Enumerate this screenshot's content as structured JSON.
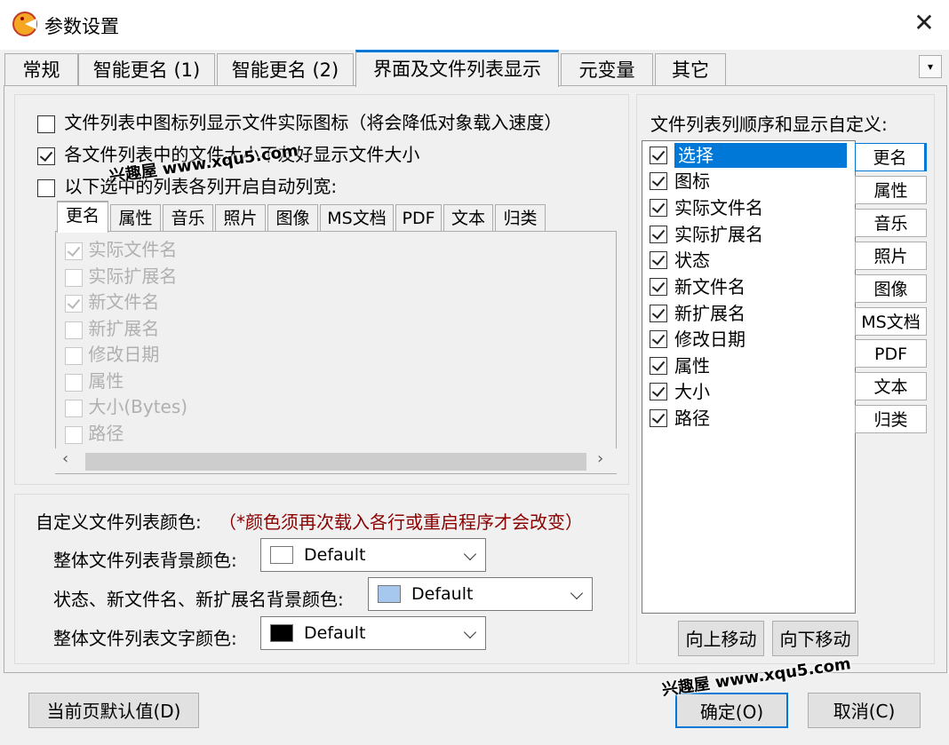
{
  "window": {
    "title": "参数设置",
    "close_glyph": "✕"
  },
  "tabs": [
    {
      "label": "常规"
    },
    {
      "label": "智能更名 (1)"
    },
    {
      "label": "智能更名 (2)"
    },
    {
      "label": "界面及文件列表显示",
      "active": true
    },
    {
      "label": "元变量"
    },
    {
      "label": "其它"
    }
  ],
  "tab_dropdown_glyph": "▾",
  "options": {
    "actual_icon": {
      "label": "文件列表中图标列显示文件实际图标（将会降低对象载入速度）",
      "checked": false
    },
    "friendly_size": {
      "label": "各文件列表中的文件大小不友好显示文件大小",
      "checked": true
    },
    "auto_width": {
      "label": "以下选中的列表各列开启自动列宽:",
      "checked": false
    }
  },
  "inner_tabs": [
    "更名",
    "属性",
    "音乐",
    "照片",
    "图像",
    "MS文档",
    "PDF",
    "文本",
    "归类"
  ],
  "inner_list": [
    {
      "label": "实际文件名",
      "checked": true
    },
    {
      "label": "实际扩展名",
      "checked": false
    },
    {
      "label": "新文件名",
      "checked": true
    },
    {
      "label": "新扩展名",
      "checked": false
    },
    {
      "label": "修改日期",
      "checked": false
    },
    {
      "label": "属性",
      "checked": false
    },
    {
      "label": "大小(Bytes)",
      "checked": false
    },
    {
      "label": "路径",
      "checked": false
    }
  ],
  "scroll": {
    "left": "‹",
    "right": "›"
  },
  "colors_section": {
    "heading": "自定义文件列表颜色:",
    "note": "（*颜色须再次载入各行或重启程序才会改变）",
    "note_color": "#8b0000",
    "rows": [
      {
        "label": "整体文件列表背景颜色:",
        "value": "Default",
        "swatch": "#ffffff"
      },
      {
        "label": "状态、新文件名、新扩展名背景颜色:",
        "value": "Default",
        "swatch": "#a6c8ee"
      },
      {
        "label": "整体文件列表文字颜色:",
        "value": "Default",
        "swatch": "#000000"
      }
    ]
  },
  "column_config": {
    "heading": "文件列表列顺序和显示自定义:",
    "items": [
      {
        "label": "选择",
        "checked": true,
        "selected": true
      },
      {
        "label": "图标",
        "checked": true
      },
      {
        "label": "实际文件名",
        "checked": true
      },
      {
        "label": "实际扩展名",
        "checked": true
      },
      {
        "label": "状态",
        "checked": true
      },
      {
        "label": "新文件名",
        "checked": true
      },
      {
        "label": "新扩展名",
        "checked": true
      },
      {
        "label": "修改日期",
        "checked": true
      },
      {
        "label": "属性",
        "checked": true
      },
      {
        "label": "大小",
        "checked": true
      },
      {
        "label": "路径",
        "checked": true
      }
    ],
    "side_buttons": [
      "更名",
      "属性",
      "音乐",
      "照片",
      "图像",
      "MS文档",
      "PDF",
      "文本",
      "归类"
    ],
    "move_up": "向上移动",
    "move_down": "向下移动"
  },
  "footer": {
    "reset": "当前页默认值(D)",
    "ok": "确定(O)",
    "cancel": "取消(C)"
  },
  "watermark": "兴趣屋 www.xqu5.com",
  "accent": "#0078d7"
}
